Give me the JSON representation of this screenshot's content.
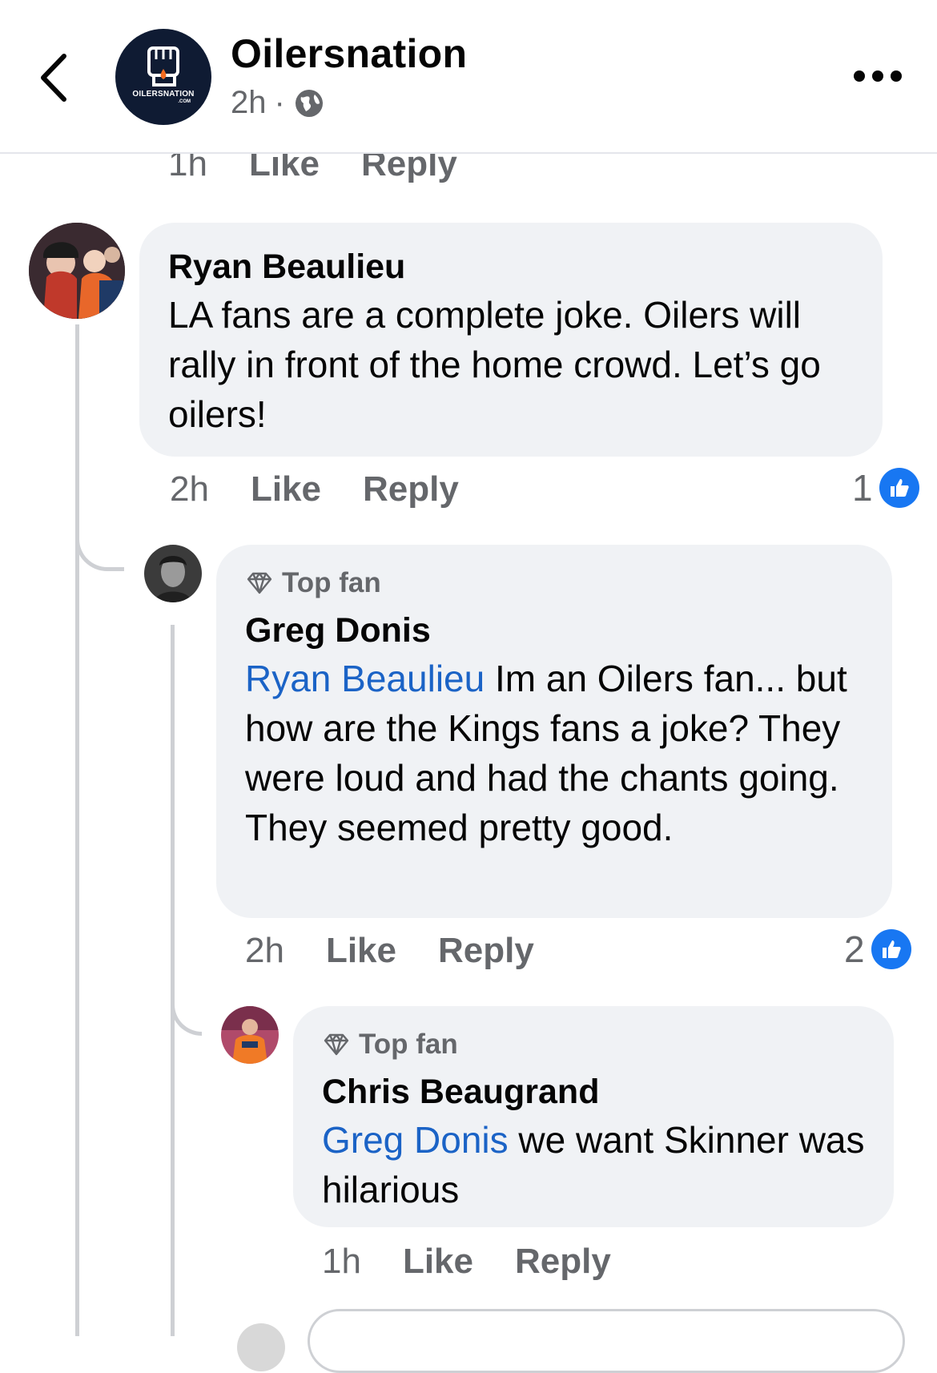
{
  "header": {
    "page_name": "Oilersnation",
    "time": "2h",
    "separator": "·",
    "logo_text": "OILERSNATION",
    "logo_sub": ".COM",
    "icons": {
      "back": "chevron-left-icon",
      "privacy": "globe-icon",
      "more": "more-dots-icon"
    }
  },
  "prev_comment": {
    "time": "1h",
    "like": "Like",
    "reply": "Reply"
  },
  "comments": [
    {
      "author": "Ryan Beaulieu",
      "text": "LA fans are a complete joke. Oilers will rally in front of the home crowd. Let’s go oilers!",
      "time": "2h",
      "like": "Like",
      "reply": "Reply",
      "reaction_count": "1"
    },
    {
      "badge": "Top fan",
      "author": "Greg Donis",
      "mention": "Ryan Beaulieu",
      "text": " Im an Oilers fan... but how are the Kings fans a joke? They were loud and had the chants going. They seemed pretty good.",
      "time": "2h",
      "like": "Like",
      "reply": "Reply",
      "reaction_count": "2"
    },
    {
      "badge": "Top fan",
      "author": "Chris Beaugrand",
      "mention": "Greg Donis",
      "text": " we want Skinner was hilarious",
      "time": "1h",
      "like": "Like",
      "reply": "Reply"
    }
  ],
  "colors": {
    "bubble": "#f0f2f5",
    "mention": "#1b63c6",
    "like": "#1877f2",
    "muted": "#65676b"
  }
}
